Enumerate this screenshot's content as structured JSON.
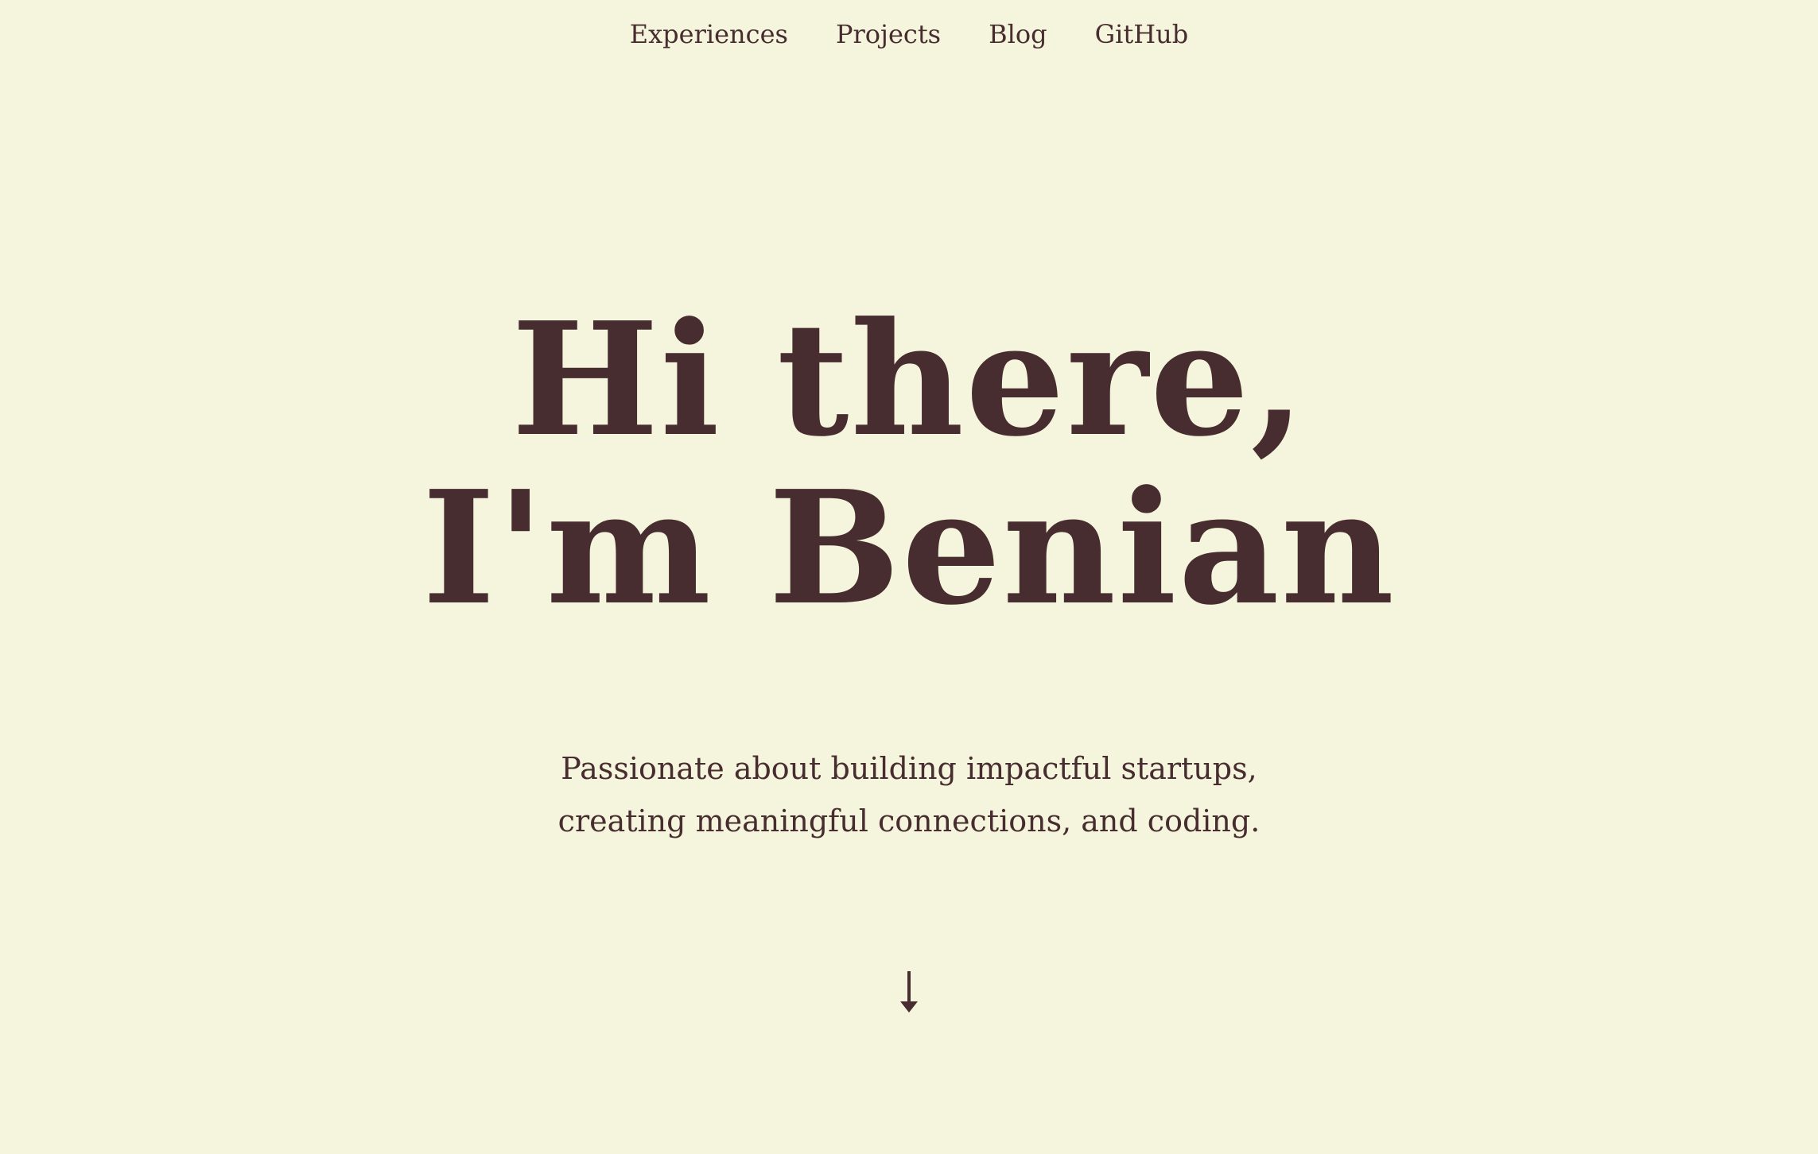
{
  "nav": {
    "items": [
      {
        "label": "Experiences"
      },
      {
        "label": "Projects"
      },
      {
        "label": "Blog"
      },
      {
        "label": "GitHub"
      }
    ]
  },
  "hero": {
    "line1": "Hi there,",
    "line2": "I'm Benian"
  },
  "tagline": {
    "line1": "Passionate about building impactful startups,",
    "line2": "creating meaningful connections, and coding."
  },
  "scroll": {
    "icon": "arrow-down-icon"
  },
  "colors": {
    "background": "#f5f4dc",
    "text": "#472d2f"
  }
}
